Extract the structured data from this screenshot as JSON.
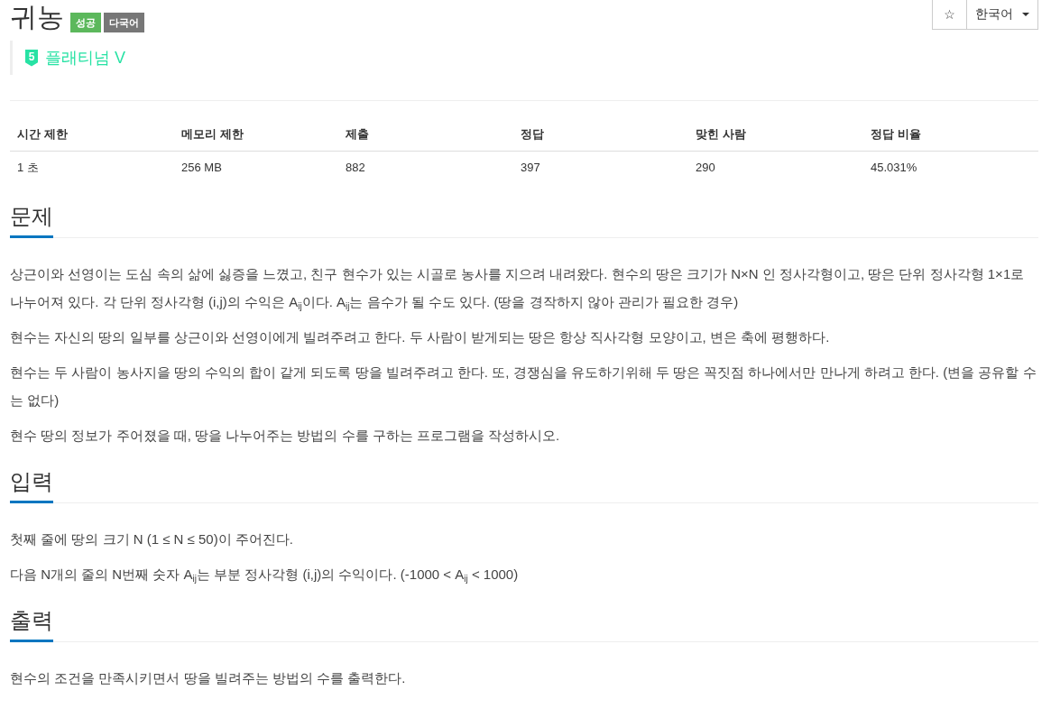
{
  "problem": {
    "title": "귀농",
    "badges": [
      {
        "label": "성공",
        "color": "#5cb85c"
      },
      {
        "label": "다국어",
        "color": "#777777"
      }
    ]
  },
  "toolbar": {
    "favorite_button": "☆",
    "language_select": "한국어"
  },
  "tier": {
    "level": "5",
    "name": "플래티넘 V"
  },
  "stats": {
    "columns": [
      "시간 제한",
      "메모리 제한",
      "제출",
      "정답",
      "맞힌 사람",
      "정답 비율"
    ],
    "rows": [
      [
        "1 초",
        "256 MB",
        "882",
        "397",
        "290",
        "45.031%"
      ]
    ]
  },
  "sections": [
    {
      "heading": "문제",
      "paragraphs": [
        "상근이와 선영이는 도심 속의 삶에 싫증을 느꼈고, 친구 현수가 있는 시골로 농사를 지으려 내려왔다. 현수의 땅은 크기가 N×N 인 정사각형이고, 땅은 단위 정사각형 1×1로 나누어져 있다. 각 단위 정사각형 (i,j)의 수익은 A$_{ij}$이다. A$_{ij}$는 음수가 될 수도 있다. (땅을 경작하지 않아 관리가 필요한 경우)",
        "현수는 자신의 땅의 일부를 상근이와 선영이에게 빌려주려고 한다. 두 사람이 받게되는 땅은 항상 직사각형 모양이고, 변은 축에 평행하다.",
        "현수는 두 사람이 농사지을 땅의 수익의 합이 같게 되도록 땅을 빌려주려고 한다. 또, 경쟁심을 유도하기위해 두 땅은 꼭짓점 하나에서만 만나게 하려고 한다. (변을 공유할 수는 없다)",
        "현수 땅의 정보가 주어졌을 때, 땅을 나누어주는 방법의 수를 구하는 프로그램을 작성하시오."
      ]
    },
    {
      "heading": "입력",
      "paragraphs": [
        "첫째 줄에 땅의 크기 N (1 ≤ N ≤ 50)이 주어진다.",
        "다음 N개의 줄의 N번째 숫자 A$_{ij}$는 부분 정사각형 (i,j)의 수익이다. (-1000 < A$_{ij}$ < 1000)"
      ]
    },
    {
      "heading": "출력",
      "paragraphs": [
        "현수의 조건을 만족시키면서 땅을 빌려주는 방법의 수를 출력한다."
      ]
    }
  ]
}
